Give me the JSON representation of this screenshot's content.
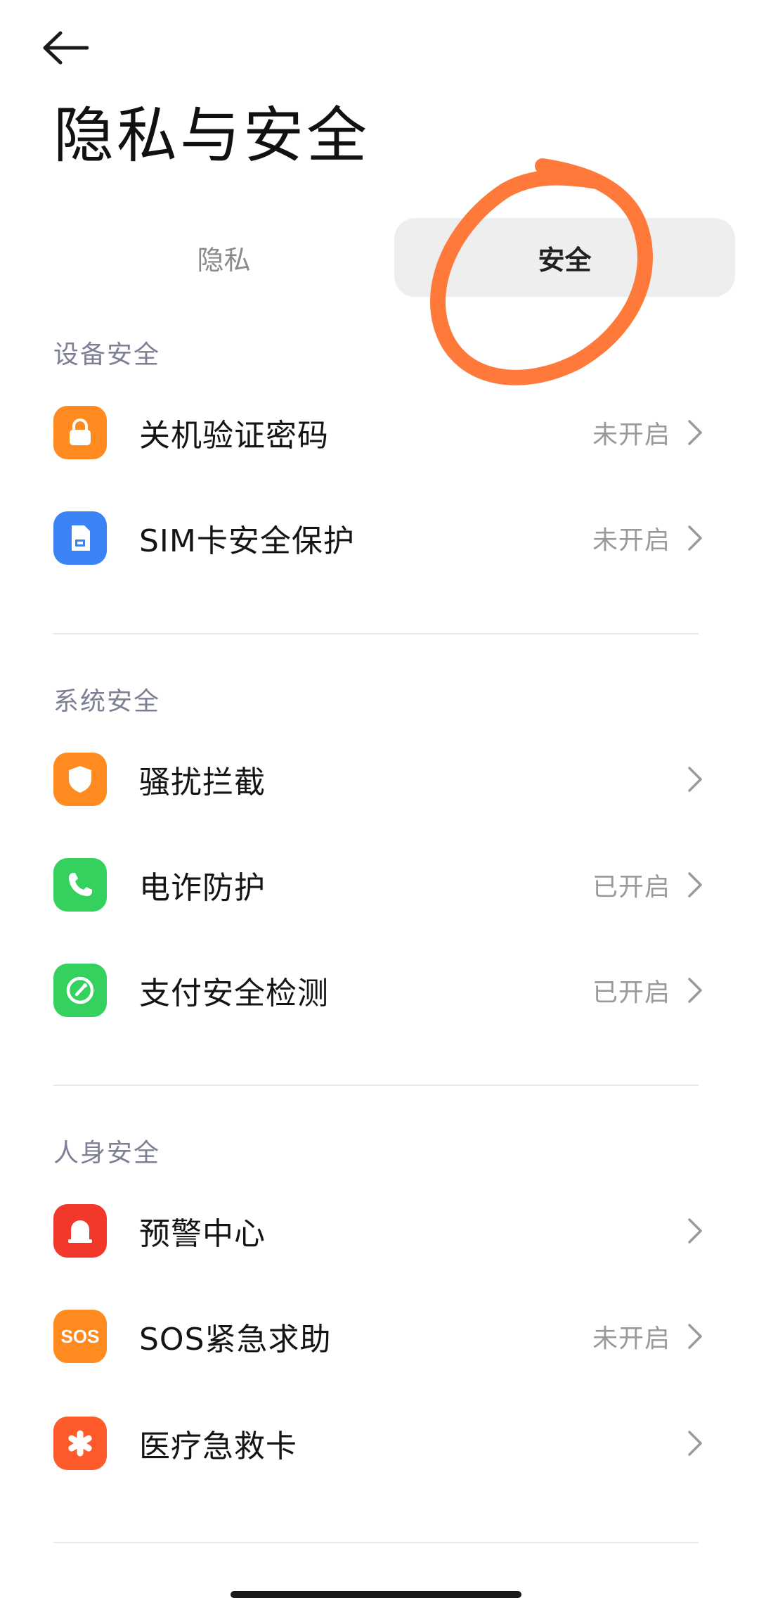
{
  "header": {
    "title": "隐私与安全"
  },
  "tabs": [
    {
      "label": "隐私",
      "active": false
    },
    {
      "label": "安全",
      "active": true
    }
  ],
  "sections": [
    {
      "title": "设备安全",
      "items": [
        {
          "label": "关机验证密码",
          "status": "未开启",
          "icon": "lock-icon",
          "color": "#FF8A1F"
        },
        {
          "label": "SIM卡安全保护",
          "status": "未开启",
          "icon": "sim-card-icon",
          "color": "#3B82F6"
        }
      ]
    },
    {
      "title": "系统安全",
      "items": [
        {
          "label": "骚扰拦截",
          "status": "",
          "icon": "shield-icon",
          "color": "#FF8A1F"
        },
        {
          "label": "电诈防护",
          "status": "已开启",
          "icon": "phone-icon",
          "color": "#34D15E"
        },
        {
          "label": "支付安全检测",
          "status": "已开启",
          "icon": "payment-check-icon",
          "color": "#34D15E"
        }
      ]
    },
    {
      "title": "人身安全",
      "items": [
        {
          "label": "预警中心",
          "status": "",
          "icon": "alert-bell-icon",
          "color": "#F2382A"
        },
        {
          "label": "SOS紧急求助",
          "status": "未开启",
          "icon": "sos-icon",
          "icon_text": "SOS",
          "color": "#FF8A1F"
        },
        {
          "label": "医疗急救卡",
          "status": "",
          "icon": "medical-icon",
          "color": "#FF5A2A"
        }
      ]
    }
  ],
  "colors": {
    "annotation": "#FF7A3A",
    "section_header": "#7D8094",
    "status_text": "#9A9A9A"
  }
}
